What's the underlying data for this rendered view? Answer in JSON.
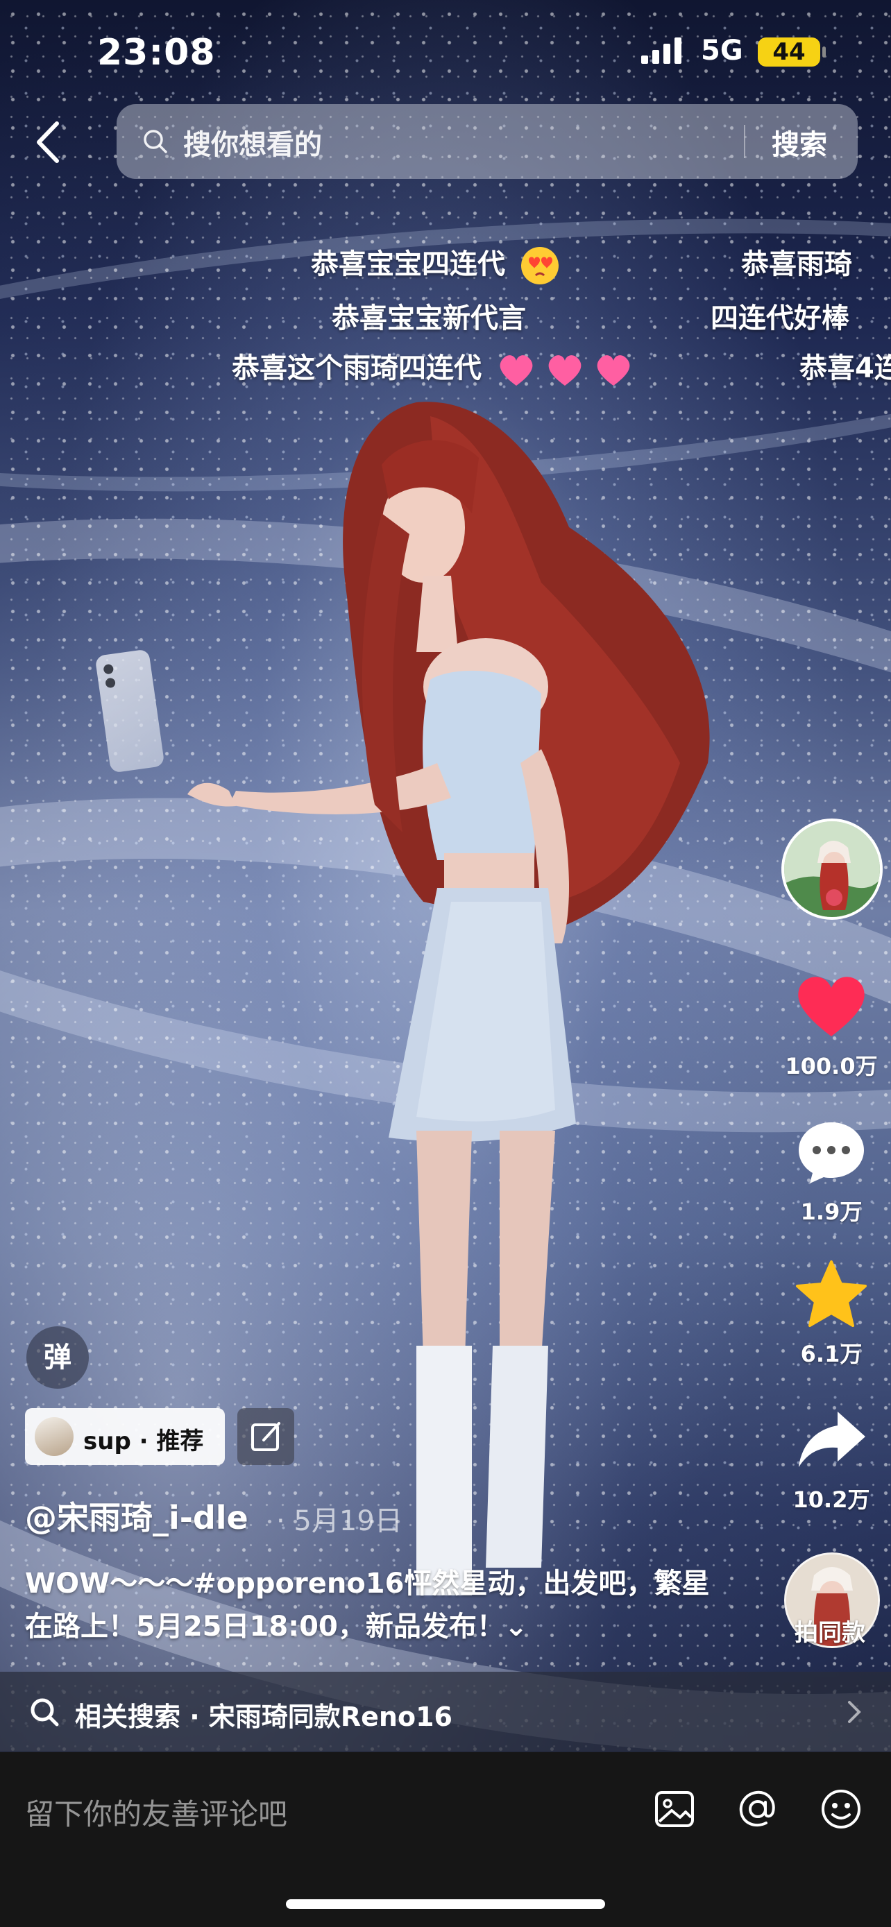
{
  "status_bar": {
    "time": "23:08",
    "network": "5G",
    "battery": "44"
  },
  "search": {
    "placeholder": "搜你想看的",
    "button": "搜索"
  },
  "danmaku": {
    "items": [
      "恭喜宝宝四连代",
      "恭喜雨琦",
      "恭喜宝宝新代言",
      "四连代好棒",
      "恭喜这个雨琦四连代",
      "恭喜4连"
    ],
    "toggle_label": "弹"
  },
  "right_rail": {
    "like_count": "100.0万",
    "comment_count": "1.9万",
    "favorite_count": "6.1万",
    "share_count": "10.2万",
    "same_style_label": "拍同款"
  },
  "recommend_chip": {
    "text": "sup · 推荐"
  },
  "post": {
    "author": "@宋雨琦_i-dle",
    "date": "· 5月19日",
    "caption_pre": "WOW～～～",
    "hashtag": "#opporeno16",
    "caption_post": "怦然星动，出发吧，繁星在路上！5月25日18:00，新品发布！⌄"
  },
  "related_search": {
    "text": "相关搜索 · 宋雨琦同款Reno16"
  },
  "comment_bar": {
    "placeholder": "留下你的友善评论吧"
  },
  "colors": {
    "like_red": "#fe2c55",
    "favorite_gold": "#ffc21a",
    "battery_yellow": "#f6d214"
  }
}
